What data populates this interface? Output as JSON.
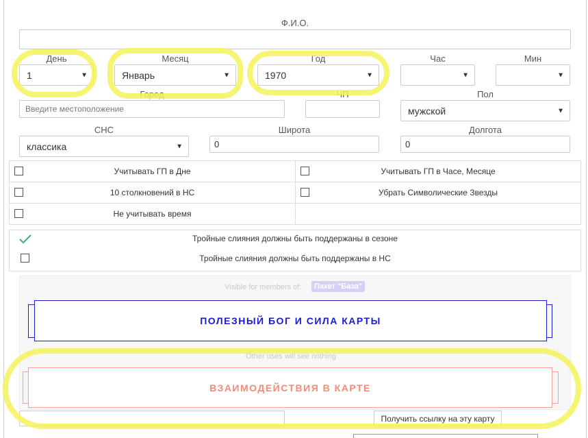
{
  "form": {
    "fio_label": "Ф.И.О.",
    "fio_value": "",
    "day_label": "День",
    "day_value": "1",
    "month_label": "Месяц",
    "month_value": "Январь",
    "year_label": "Год",
    "year_value": "1970",
    "hour_label": "Час",
    "hour_value": "",
    "min_label": "Мин",
    "min_value": "",
    "city_label": "Город",
    "city_placeholder": "Введите местоположение",
    "tz_label": "ЧП",
    "tz_value": "",
    "sex_label": "Пол",
    "sex_value": "мужской",
    "cns_label": "СНС",
    "cns_value": "классика",
    "lat_label": "Широта",
    "lat_value": "0",
    "lon_label": "Долгота",
    "lon_value": "0"
  },
  "options": [
    {
      "label": "Учитывать ГП в Дне",
      "checked": false
    },
    {
      "label": "Учитывать ГП в Часе, Месяце",
      "checked": false
    },
    {
      "label": "10 столкновений в НС",
      "checked": false
    },
    {
      "label": "Убрать Символические Звезды",
      "checked": false
    },
    {
      "label": "Не учитывать время",
      "checked": false
    }
  ],
  "season": [
    {
      "label": "Тройные слияния должны быть поддержаны в сезоне",
      "checked": true
    },
    {
      "label": "Тройные слияния должны быть поддержаны в НС",
      "checked": false
    }
  ],
  "members": {
    "visible_text": "Visible for members of:",
    "badge": "Пакет \"База\"",
    "other_text": "Other uses will see nothing"
  },
  "buttons": {
    "useful_god": "ПОЛЕЗНЫЙ БОГ И СИЛА КАРТЫ",
    "interactions": "ВЗАИМОДЕЙСТВИЯ В КАРТЕ",
    "get_link": "Получить ссылку на эту карту"
  },
  "colors": {
    "highlight": "#f5f25a",
    "primary_button": "#1a1ad0",
    "secondary_button": "#f08b78",
    "check": "#3aa99f"
  },
  "icons": {
    "dropdown": "caret-down-icon",
    "checkmark": "check-icon"
  }
}
